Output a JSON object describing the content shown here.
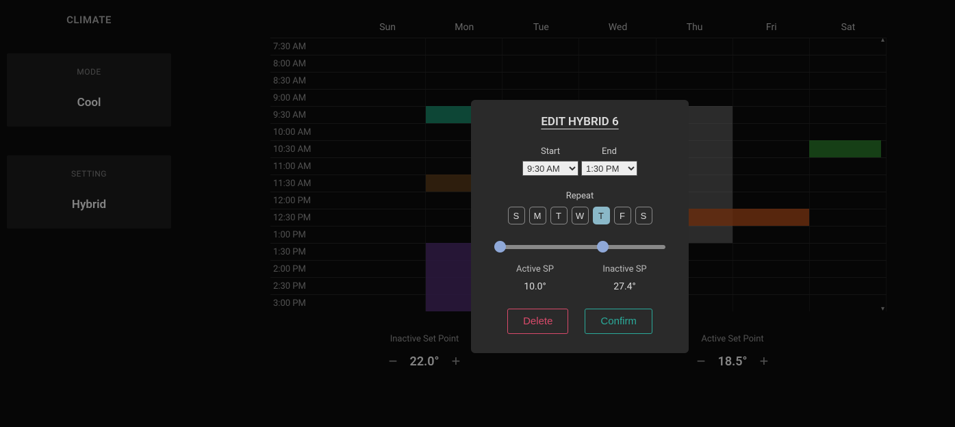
{
  "sidebar": {
    "title": "CLIMATE",
    "mode": {
      "label": "MODE",
      "value": "Cool"
    },
    "setting": {
      "label": "SETTING",
      "value": "Hybrid"
    }
  },
  "days": [
    "Sun",
    "Mon",
    "Tue",
    "Wed",
    "Thu",
    "Fri",
    "Sat"
  ],
  "times": [
    "7:30 AM",
    "8:00 AM",
    "8:30 AM",
    "9:00 AM",
    "9:30 AM",
    "10:00 AM",
    "10:30 AM",
    "11:00 AM",
    "11:30 AM",
    "12:00 PM",
    "12:30 PM",
    "1:00 PM",
    "1:30 PM",
    "2:00 PM",
    "2:30 PM",
    "3:00 PM"
  ],
  "footer": {
    "inactive": {
      "label": "Inactive Set Point",
      "value": "22.0°"
    },
    "active": {
      "label": "Active Set Point",
      "value": "18.5°"
    }
  },
  "modal": {
    "title": "EDIT HYBRID 6",
    "startLabel": "Start",
    "endLabel": "End",
    "startValue": "9:30 AM",
    "endValue": "1:30 PM",
    "repeatLabel": "Repeat",
    "dayToggles": [
      "S",
      "M",
      "T",
      "W",
      "T",
      "F",
      "S"
    ],
    "activeDayIndex": 4,
    "activeSpLabel": "Active SP",
    "activeSpValue": "10.0°",
    "inactiveSpLabel": "Inactive SP",
    "inactiveSpValue": "27.4°",
    "deleteLabel": "Delete",
    "confirmLabel": "Confirm"
  }
}
